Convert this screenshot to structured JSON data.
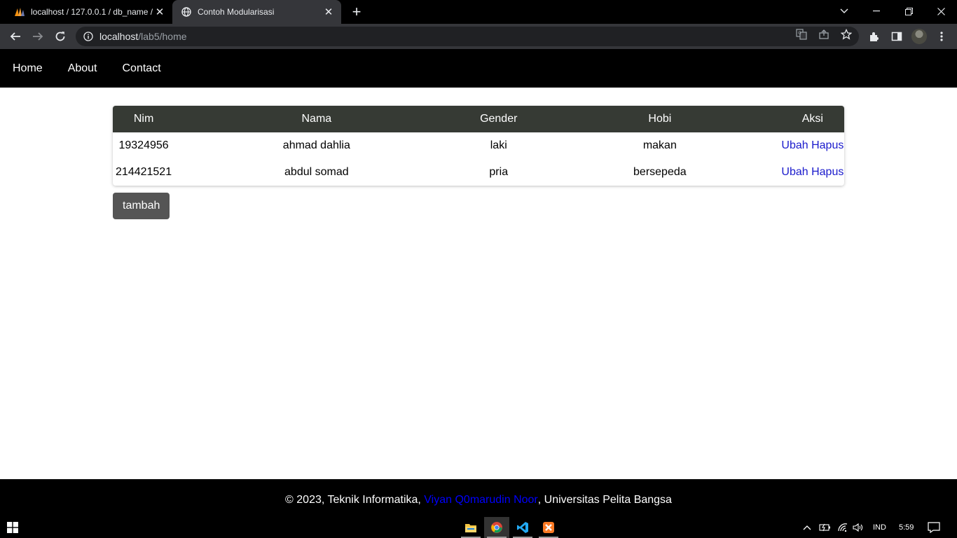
{
  "browser": {
    "tabs": [
      {
        "title": "localhost / 127.0.0.1 / db_name /",
        "active": false,
        "icon": "phpmyadmin-icon"
      },
      {
        "title": "Contoh Modularisasi",
        "active": true,
        "icon": "globe-icon"
      }
    ],
    "url_host": "localhost",
    "url_path": "/lab5/home"
  },
  "site": {
    "nav": [
      "Home",
      "About",
      "Contact"
    ],
    "table": {
      "headers": [
        "Nim",
        "Nama",
        "Gender",
        "Hobi",
        "Aksi"
      ],
      "rows": [
        {
          "nim": "19324956",
          "nama": "ahmad dahlia",
          "gender": "laki",
          "hobi": "makan",
          "ubah": "Ubah",
          "hapus": "Hapus"
        },
        {
          "nim": "214421521",
          "nama": "abdul somad",
          "gender": "pria",
          "hobi": "bersepeda",
          "ubah": "Ubah",
          "hapus": "Hapus"
        }
      ]
    },
    "add_button": "tambah",
    "footer": {
      "prefix": "© 2023, Teknik Informatika, ",
      "author": "Viyan Q0marudin Noor",
      "suffix": ", Universitas Pelita Bangsa"
    }
  },
  "taskbar": {
    "apps": [
      "file-explorer-icon",
      "chrome-icon",
      "vscode-icon",
      "xampp-icon"
    ],
    "language": "IND",
    "time": "5:59"
  },
  "colors": {
    "nav_bg": "#000000",
    "table_header_bg": "#363a34",
    "link": "#1a1acc",
    "button_bg": "#555555",
    "footer_author": "#0000ff"
  }
}
